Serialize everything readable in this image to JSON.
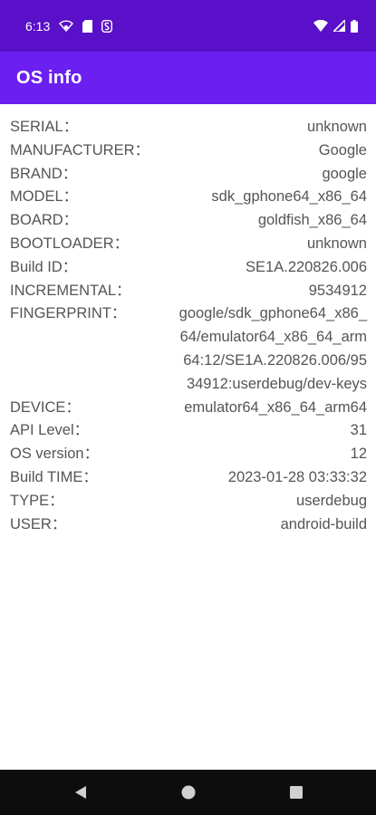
{
  "status_bar": {
    "time": "6:13",
    "left_icons": [
      "wifi-sync-icon",
      "sim-card-icon",
      "s-app-icon"
    ],
    "right_icons": [
      "wifi-icon",
      "signal-icon",
      "battery-icon"
    ]
  },
  "app_bar": {
    "title": "OS info"
  },
  "info": [
    {
      "key": "SERIAL：",
      "value": "unknown"
    },
    {
      "key": "MANUFACTURER：",
      "value": "Google"
    },
    {
      "key": "BRAND：",
      "value": "google"
    },
    {
      "key": "MODEL：",
      "value": "sdk_gphone64_x86_64"
    },
    {
      "key": "BOARD：",
      "value": "goldfish_x86_64"
    },
    {
      "key": "BOOTLOADER：",
      "value": "unknown"
    },
    {
      "key": "Build ID：",
      "value": "SE1A.220826.006"
    },
    {
      "key": "INCREMENTAL：",
      "value": "9534912"
    },
    {
      "key": "FINGERPRINT：",
      "value": "google/sdk_gphone64_x86_64/emulator64_x86_64_arm64:12/SE1A.220826.006/9534912:userdebug/dev-keys"
    },
    {
      "key": "DEVICE：",
      "value": "emulator64_x86_64_arm64"
    },
    {
      "key": "API Level：",
      "value": "31"
    },
    {
      "key": "OS version：",
      "value": "12"
    },
    {
      "key": "Build TIME：",
      "value": "2023-01-28 03:33:32"
    },
    {
      "key": "TYPE：",
      "value": "userdebug"
    },
    {
      "key": "USER：",
      "value": "android-build"
    }
  ],
  "nav_bar": {
    "icons": [
      "back-icon",
      "home-icon",
      "recents-icon"
    ]
  },
  "colors": {
    "status_bar": "#5a10c8",
    "app_bar": "#6b1ff0",
    "text": "#555555",
    "nav_bar": "#0d0d0d"
  }
}
